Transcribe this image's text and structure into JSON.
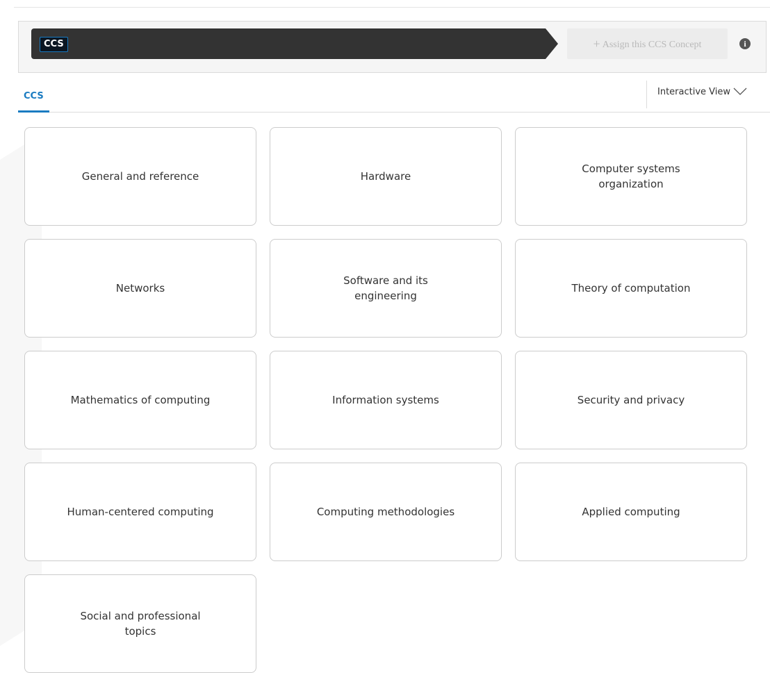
{
  "concept_bar": {
    "badge": "CCS",
    "assign_label": "Assign this CCS Concept",
    "assign_icon": "plus-icon",
    "info_icon": "info-icon",
    "info_glyph": "i"
  },
  "tabs": {
    "active": "CCS",
    "view_label": "Interactive View",
    "view_icon": "chevron-down-icon"
  },
  "colors": {
    "accent": "#1a7bc1",
    "breadcrumb_bg": "#333333",
    "card_border": "#cccccc"
  },
  "cards": [
    {
      "label": "General and reference"
    },
    {
      "label": "Hardware"
    },
    {
      "label": "Computer systems organization"
    },
    {
      "label": "Networks"
    },
    {
      "label": "Software and its engineering"
    },
    {
      "label": "Theory of computation"
    },
    {
      "label": "Mathematics of computing"
    },
    {
      "label": "Information systems"
    },
    {
      "label": "Security and privacy"
    },
    {
      "label": "Human-centered computing"
    },
    {
      "label": "Computing methodologies"
    },
    {
      "label": "Applied computing"
    },
    {
      "label": "Social and professional topics"
    }
  ]
}
